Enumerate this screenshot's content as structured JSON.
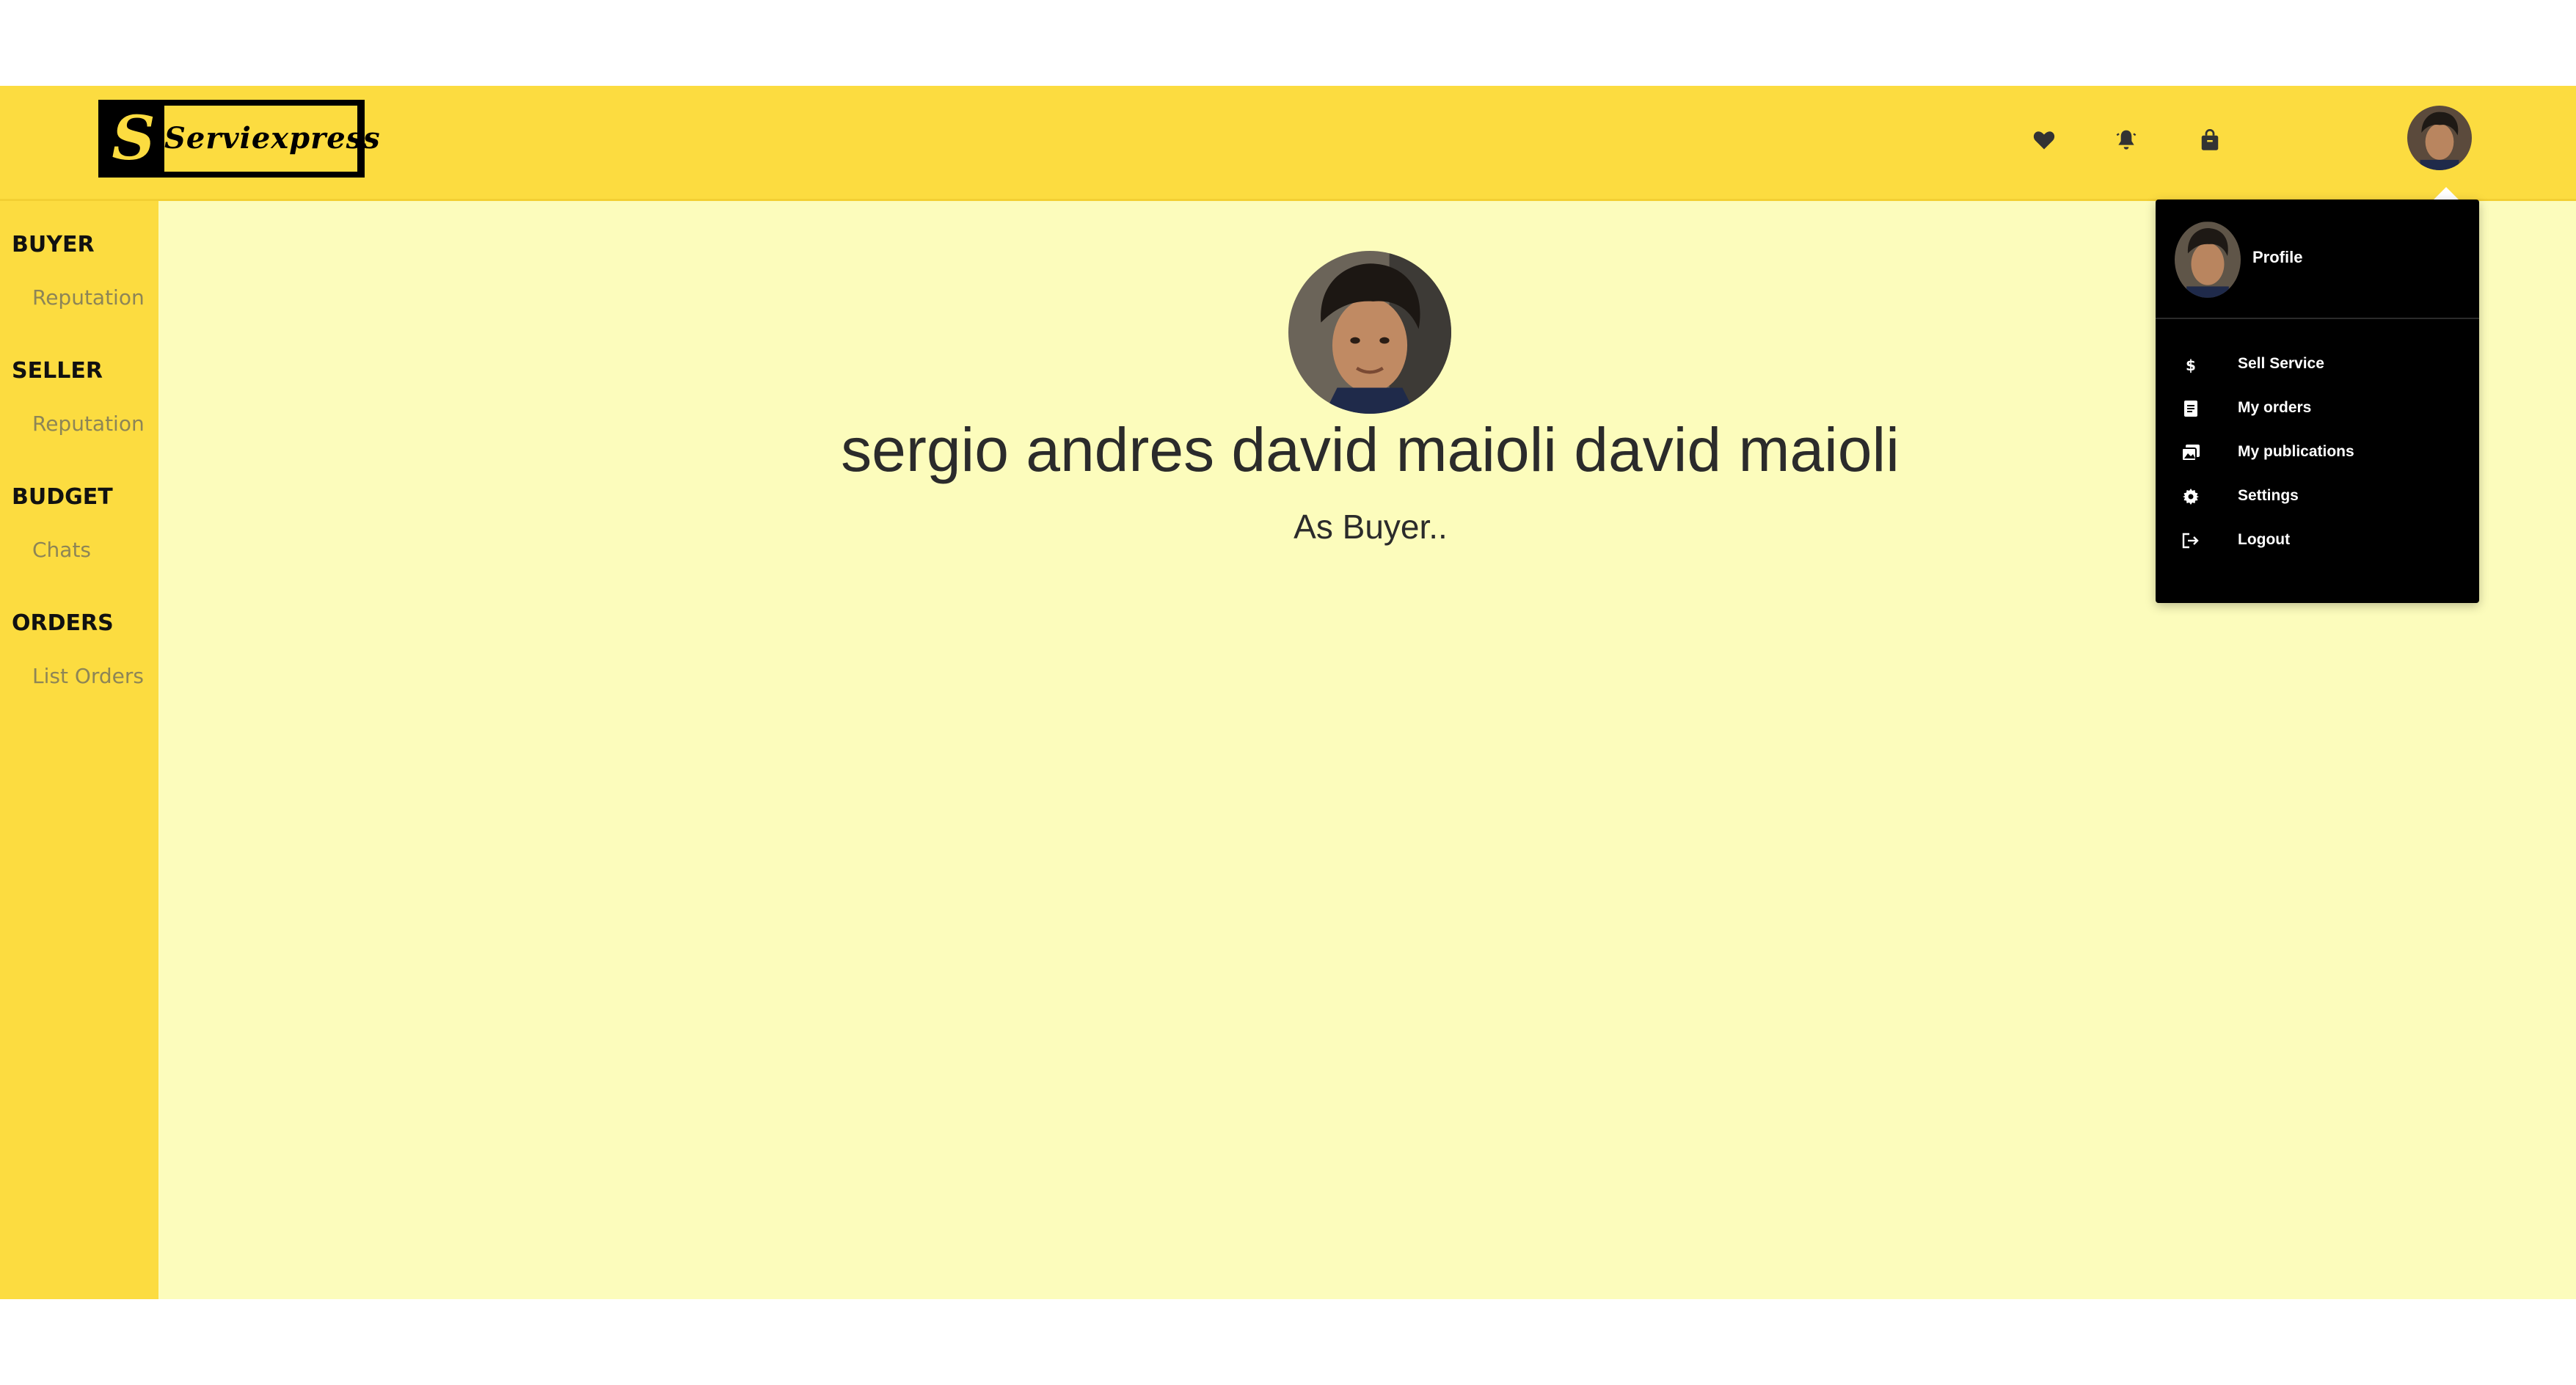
{
  "brand": {
    "mark": "S",
    "name": "Serviexpress"
  },
  "header": {
    "icons": [
      "heart-icon",
      "bell-icon",
      "shopping-bag-icon"
    ],
    "avatar": "user-avatar"
  },
  "sidebar": {
    "sections": [
      {
        "heading": "BUYER",
        "link": "Reputation"
      },
      {
        "heading": "SELLER",
        "link": "Reputation"
      },
      {
        "heading": "BUDGET",
        "link": "Chats"
      },
      {
        "heading": "ORDERS",
        "link": "List Orders"
      }
    ]
  },
  "main": {
    "user_name": "sergio andres david maioli david maioli",
    "subtitle": "As Buyer.."
  },
  "dropdown": {
    "profile_label": "Profile",
    "items": [
      {
        "label": "Sell Service",
        "icon": "dollar-icon"
      },
      {
        "label": "My orders",
        "icon": "document-icon"
      },
      {
        "label": "My publications",
        "icon": "images-icon"
      },
      {
        "label": "Settings",
        "icon": "gear-icon"
      },
      {
        "label": "Logout",
        "icon": "logout-icon"
      }
    ]
  },
  "colors": {
    "header": "#fcdc40",
    "sidebar": "#fcdc40",
    "content_bg": "#fcfcbc",
    "dropdown_bg": "#000000",
    "sidebar_link": "#8d8556"
  }
}
